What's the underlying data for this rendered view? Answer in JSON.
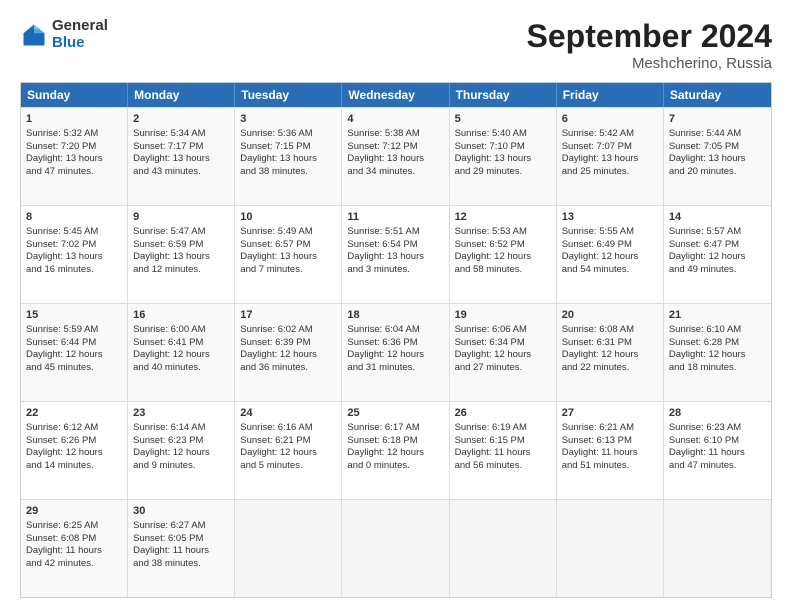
{
  "logo": {
    "general": "General",
    "blue": "Blue"
  },
  "title": {
    "month_year": "September 2024",
    "location": "Meshcherino, Russia"
  },
  "calendar": {
    "headers": [
      "Sunday",
      "Monday",
      "Tuesday",
      "Wednesday",
      "Thursday",
      "Friday",
      "Saturday"
    ],
    "rows": [
      [
        {
          "day": "",
          "empty": true
        },
        {
          "day": "2",
          "line1": "Sunrise: 5:34 AM",
          "line2": "Sunset: 7:17 PM",
          "line3": "Daylight: 13 hours",
          "line4": "and 43 minutes."
        },
        {
          "day": "3",
          "line1": "Sunrise: 5:36 AM",
          "line2": "Sunset: 7:15 PM",
          "line3": "Daylight: 13 hours",
          "line4": "and 38 minutes."
        },
        {
          "day": "4",
          "line1": "Sunrise: 5:38 AM",
          "line2": "Sunset: 7:12 PM",
          "line3": "Daylight: 13 hours",
          "line4": "and 34 minutes."
        },
        {
          "day": "5",
          "line1": "Sunrise: 5:40 AM",
          "line2": "Sunset: 7:10 PM",
          "line3": "Daylight: 13 hours",
          "line4": "and 29 minutes."
        },
        {
          "day": "6",
          "line1": "Sunrise: 5:42 AM",
          "line2": "Sunset: 7:07 PM",
          "line3": "Daylight: 13 hours",
          "line4": "and 25 minutes."
        },
        {
          "day": "7",
          "line1": "Sunrise: 5:44 AM",
          "line2": "Sunset: 7:05 PM",
          "line3": "Daylight: 13 hours",
          "line4": "and 20 minutes."
        }
      ],
      [
        {
          "day": "8",
          "line1": "Sunrise: 5:45 AM",
          "line2": "Sunset: 7:02 PM",
          "line3": "Daylight: 13 hours",
          "line4": "and 16 minutes."
        },
        {
          "day": "9",
          "line1": "Sunrise: 5:47 AM",
          "line2": "Sunset: 6:59 PM",
          "line3": "Daylight: 13 hours",
          "line4": "and 12 minutes."
        },
        {
          "day": "10",
          "line1": "Sunrise: 5:49 AM",
          "line2": "Sunset: 6:57 PM",
          "line3": "Daylight: 13 hours",
          "line4": "and 7 minutes."
        },
        {
          "day": "11",
          "line1": "Sunrise: 5:51 AM",
          "line2": "Sunset: 6:54 PM",
          "line3": "Daylight: 13 hours",
          "line4": "and 3 minutes."
        },
        {
          "day": "12",
          "line1": "Sunrise: 5:53 AM",
          "line2": "Sunset: 6:52 PM",
          "line3": "Daylight: 12 hours",
          "line4": "and 58 minutes."
        },
        {
          "day": "13",
          "line1": "Sunrise: 5:55 AM",
          "line2": "Sunset: 6:49 PM",
          "line3": "Daylight: 12 hours",
          "line4": "and 54 minutes."
        },
        {
          "day": "14",
          "line1": "Sunrise: 5:57 AM",
          "line2": "Sunset: 6:47 PM",
          "line3": "Daylight: 12 hours",
          "line4": "and 49 minutes."
        }
      ],
      [
        {
          "day": "15",
          "line1": "Sunrise: 5:59 AM",
          "line2": "Sunset: 6:44 PM",
          "line3": "Daylight: 12 hours",
          "line4": "and 45 minutes."
        },
        {
          "day": "16",
          "line1": "Sunrise: 6:00 AM",
          "line2": "Sunset: 6:41 PM",
          "line3": "Daylight: 12 hours",
          "line4": "and 40 minutes."
        },
        {
          "day": "17",
          "line1": "Sunrise: 6:02 AM",
          "line2": "Sunset: 6:39 PM",
          "line3": "Daylight: 12 hours",
          "line4": "and 36 minutes."
        },
        {
          "day": "18",
          "line1": "Sunrise: 6:04 AM",
          "line2": "Sunset: 6:36 PM",
          "line3": "Daylight: 12 hours",
          "line4": "and 31 minutes."
        },
        {
          "day": "19",
          "line1": "Sunrise: 6:06 AM",
          "line2": "Sunset: 6:34 PM",
          "line3": "Daylight: 12 hours",
          "line4": "and 27 minutes."
        },
        {
          "day": "20",
          "line1": "Sunrise: 6:08 AM",
          "line2": "Sunset: 6:31 PM",
          "line3": "Daylight: 12 hours",
          "line4": "and 22 minutes."
        },
        {
          "day": "21",
          "line1": "Sunrise: 6:10 AM",
          "line2": "Sunset: 6:28 PM",
          "line3": "Daylight: 12 hours",
          "line4": "and 18 minutes."
        }
      ],
      [
        {
          "day": "22",
          "line1": "Sunrise: 6:12 AM",
          "line2": "Sunset: 6:26 PM",
          "line3": "Daylight: 12 hours",
          "line4": "and 14 minutes."
        },
        {
          "day": "23",
          "line1": "Sunrise: 6:14 AM",
          "line2": "Sunset: 6:23 PM",
          "line3": "Daylight: 12 hours",
          "line4": "and 9 minutes."
        },
        {
          "day": "24",
          "line1": "Sunrise: 6:16 AM",
          "line2": "Sunset: 6:21 PM",
          "line3": "Daylight: 12 hours",
          "line4": "and 5 minutes."
        },
        {
          "day": "25",
          "line1": "Sunrise: 6:17 AM",
          "line2": "Sunset: 6:18 PM",
          "line3": "Daylight: 12 hours",
          "line4": "and 0 minutes."
        },
        {
          "day": "26",
          "line1": "Sunrise: 6:19 AM",
          "line2": "Sunset: 6:15 PM",
          "line3": "Daylight: 11 hours",
          "line4": "and 56 minutes."
        },
        {
          "day": "27",
          "line1": "Sunrise: 6:21 AM",
          "line2": "Sunset: 6:13 PM",
          "line3": "Daylight: 11 hours",
          "line4": "and 51 minutes."
        },
        {
          "day": "28",
          "line1": "Sunrise: 6:23 AM",
          "line2": "Sunset: 6:10 PM",
          "line3": "Daylight: 11 hours",
          "line4": "and 47 minutes."
        }
      ],
      [
        {
          "day": "29",
          "line1": "Sunrise: 6:25 AM",
          "line2": "Sunset: 6:08 PM",
          "line3": "Daylight: 11 hours",
          "line4": "and 42 minutes."
        },
        {
          "day": "30",
          "line1": "Sunrise: 6:27 AM",
          "line2": "Sunset: 6:05 PM",
          "line3": "Daylight: 11 hours",
          "line4": "and 38 minutes."
        },
        {
          "day": "",
          "empty": true
        },
        {
          "day": "",
          "empty": true
        },
        {
          "day": "",
          "empty": true
        },
        {
          "day": "",
          "empty": true
        },
        {
          "day": "",
          "empty": true
        }
      ]
    ],
    "first_row_special": {
      "day1": {
        "day": "1",
        "line1": "Sunrise: 5:32 AM",
        "line2": "Sunset: 7:20 PM",
        "line3": "Daylight: 13 hours",
        "line4": "and 47 minutes."
      }
    }
  }
}
